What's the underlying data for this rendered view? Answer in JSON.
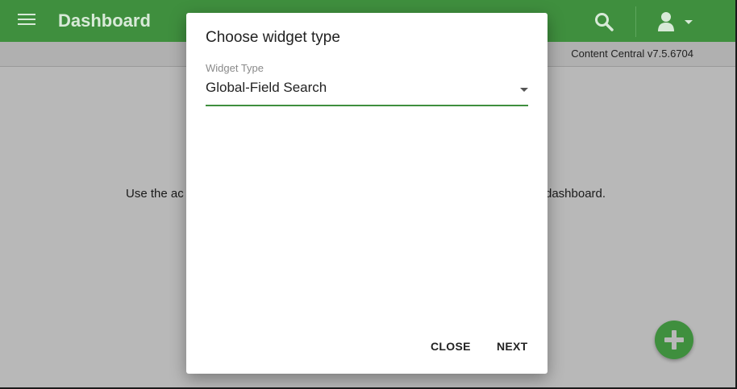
{
  "appbar": {
    "title": "Dashboard",
    "icons": {
      "menu": "menu-icon",
      "search": "search-icon",
      "user": "user-icon",
      "user_menu": "chevron-down-icon"
    }
  },
  "subbar": {
    "version": "Content Central v7.5.6704"
  },
  "main": {
    "hint_left": "Use the ac",
    "hint_right": "dashboard.",
    "fab_icon": "add-icon"
  },
  "dialog": {
    "title": "Choose widget type",
    "field_label": "Widget Type",
    "selected_value": "Global-Field Search",
    "close_label": "CLOSE",
    "next_label": "NEXT"
  },
  "colors": {
    "primary": "#3f8f3e",
    "overlay": "#b8b8b8",
    "surface": "#ffffff"
  }
}
